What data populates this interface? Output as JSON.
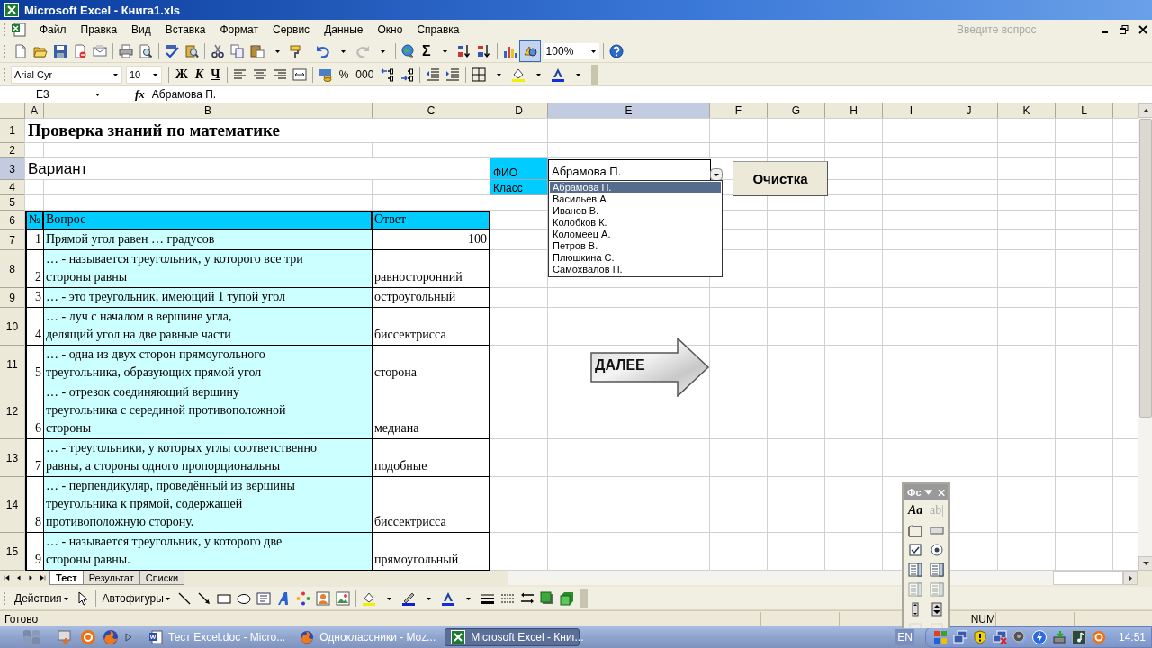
{
  "window": {
    "title": "Microsoft Excel - Книга1.xls"
  },
  "menu": [
    "Файл",
    "Правка",
    "Вид",
    "Вставка",
    "Формат",
    "Сервис",
    "Данные",
    "Окно",
    "Справка"
  ],
  "help_search": {
    "placeholder": "Введите вопрос"
  },
  "standard_toolbar": {
    "sum": "Σ",
    "zoom": "100%"
  },
  "formatting_toolbar": {
    "font": "Arial Cyr",
    "size": "10",
    "bold": "Ж",
    "italic": "К",
    "underline": "Ч",
    "percent": "%",
    "thousands": "000"
  },
  "formula_bar": {
    "name_box": "E3",
    "fx": "fx",
    "value": "Абрамова П."
  },
  "sheet": {
    "columns": [
      {
        "label": "A",
        "selected": false
      },
      {
        "label": "B",
        "selected": false
      },
      {
        "label": "C",
        "selected": false
      },
      {
        "label": "D",
        "selected": false
      },
      {
        "label": "E",
        "selected": true
      },
      {
        "label": "F",
        "selected": false
      },
      {
        "label": "G",
        "selected": false
      },
      {
        "label": "H",
        "selected": false
      },
      {
        "label": "I",
        "selected": false
      },
      {
        "label": "J",
        "selected": false
      },
      {
        "label": "K",
        "selected": false
      },
      {
        "label": "L",
        "selected": false
      }
    ],
    "rows": [
      {
        "label": "1",
        "selected": false
      },
      {
        "label": "2",
        "selected": false
      },
      {
        "label": "3",
        "selected": true
      },
      {
        "label": "4",
        "selected": false
      },
      {
        "label": "5",
        "selected": false
      },
      {
        "label": "6",
        "selected": false
      },
      {
        "label": "7",
        "selected": false
      },
      {
        "label": "8",
        "selected": false
      },
      {
        "label": "9",
        "selected": false
      },
      {
        "label": "10",
        "selected": false
      },
      {
        "label": "11",
        "selected": false
      },
      {
        "label": "12",
        "selected": false
      },
      {
        "label": "13",
        "selected": false
      },
      {
        "label": "14",
        "selected": false
      },
      {
        "label": "15",
        "selected": false
      }
    ],
    "title": "Проверка знаний по математике",
    "variant": "Вариант",
    "fio_label": "ФИО",
    "class_label": "Класс",
    "table": {
      "header": {
        "number": "№",
        "question": "Вопрос",
        "answer": "Ответ"
      },
      "rows": [
        {
          "number": "1",
          "question": "Прямой угол равен … градусов",
          "answer": "100"
        },
        {
          "number": "2",
          "question": "… - называется треугольник, у которого все три\nстороны равны",
          "answer": "равносторонний"
        },
        {
          "number": "3",
          "question": "… - это треугольник, имеющий 1 тупой угол",
          "answer": "остроугольный"
        },
        {
          "number": "4",
          "question": "… - луч с началом в вершине угла,\nделящий угол на две равные части",
          "answer": "биссектрисса"
        },
        {
          "number": "5",
          "question": "… - одна из двух сторон прямоугольного\nтреугольника, образующих прямой угол",
          "answer": "сторона"
        },
        {
          "number": "6",
          "question": "… - отрезок соединяющий вершину\nтреугольника с серединой противоположной\nстороны",
          "answer": "медиана"
        },
        {
          "number": "7",
          "question": "… - треугольники, у которых углы соответственно\nравны, а стороны одного пропорциональны",
          "answer": "подобные"
        },
        {
          "number": "8",
          "question": "… - перпендикуляр, проведённый из вершины\nтреугольника к прямой, содержащей\nпротивоположную сторону.",
          "answer": "биссектрисса"
        },
        {
          "number": "9",
          "question": "… - называется треугольник, у которого две\nстороны равны.",
          "answer": "прямоугольный"
        }
      ]
    }
  },
  "combo": {
    "value": "Абрамова П.",
    "expanded": true,
    "options": [
      {
        "label": "Абрамова П.",
        "selected": true
      },
      {
        "label": "Васильев А.",
        "selected": false
      },
      {
        "label": "Иванов В.",
        "selected": false
      },
      {
        "label": "Колобков К.",
        "selected": false
      },
      {
        "label": "Коломеец А.",
        "selected": false
      },
      {
        "label": "Петров В.",
        "selected": false
      },
      {
        "label": "Плюшкина С.",
        "selected": false
      },
      {
        "label": "Самохвалов П.",
        "selected": false
      }
    ]
  },
  "clear_button": "Очистка",
  "next_arrow": "ДАЛЕЕ",
  "sheet_tabs": [
    {
      "label": "Тест",
      "selected": true
    },
    {
      "label": "Результат",
      "selected": false
    },
    {
      "label": "Списки",
      "selected": false
    }
  ],
  "drawing_toolbar": {
    "actions": "Действия",
    "autoshapes": "Автофигуры"
  },
  "forms_toolbar": {
    "title": "Фс",
    "label_tool": "Aa",
    "edit_tool": "ab|"
  },
  "status_bar": {
    "text": "Готово",
    "num": "NUM"
  },
  "taskbar": {
    "tasks": [
      {
        "label": "Тест Excel.doc - Micro...",
        "selected": false,
        "kind": "word"
      },
      {
        "label": "Одноклассники - Moz...",
        "selected": false,
        "kind": "browser"
      },
      {
        "label": "Microsoft Excel - Книг...",
        "selected": true,
        "kind": "excel"
      }
    ],
    "language": "EN",
    "clock": "14:51"
  }
}
